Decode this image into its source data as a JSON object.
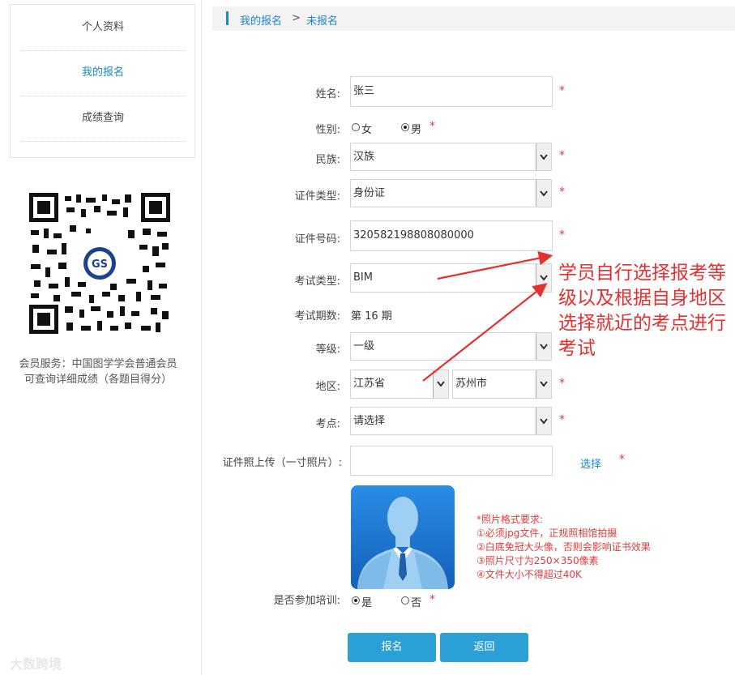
{
  "sidebar": {
    "items": [
      {
        "label": "个人资料",
        "active": false
      },
      {
        "label": "我的报名",
        "active": true
      },
      {
        "label": "成绩查询",
        "active": false
      }
    ],
    "member_service": "会员服务：中国图学学会普通会员可查询详细成绩（各题目得分）"
  },
  "breadcrumb": {
    "root": "我的报名",
    "separator": ">",
    "current": "未报名"
  },
  "form": {
    "name": {
      "label": "姓名:",
      "value": "张三"
    },
    "gender": {
      "label": "性别:",
      "options": [
        "女",
        "男"
      ],
      "selected": "男"
    },
    "ethnicity": {
      "label": "民族:",
      "value": "汉族"
    },
    "id_type": {
      "label": "证件类型:",
      "value": "身份证"
    },
    "id_number": {
      "label": "证件号码:",
      "value": "320582198808080000"
    },
    "exam_type": {
      "label": "考试类型:",
      "value": "BIM"
    },
    "exam_session": {
      "label": "考试期数:",
      "value": "第 16 期"
    },
    "level": {
      "label": "等级:",
      "value": "一级"
    },
    "region": {
      "label": "地区:",
      "province": "江苏省",
      "city": "苏州市"
    },
    "exam_site": {
      "label": "考点:",
      "value": "请选择"
    },
    "photo_upload": {
      "label": "证件照上传（一寸照片）:",
      "choose": "选择"
    },
    "photo_requirements": [
      "*照片格式要求:",
      "①必须jpg文件，正规照相馆拍摄",
      "②白底免冠大头像，否则会影响证书效果",
      "③照片尺寸为250×350像素",
      "④文件大小不得超过40K"
    ],
    "training": {
      "label": "是否参加培训:",
      "options": [
        "是",
        "否"
      ],
      "selected": "是"
    },
    "required_mark": "*"
  },
  "buttons": {
    "submit": "报名",
    "back": "返回"
  },
  "annotation": "学员自行选择报考等级以及根据自身地区选择就近的考点进行考试",
  "watermark": "大数跨境",
  "colors": {
    "accent": "#1a88c8",
    "button": "#2aa0d6",
    "required": "#e03b3b",
    "annotation": "#e53030"
  }
}
